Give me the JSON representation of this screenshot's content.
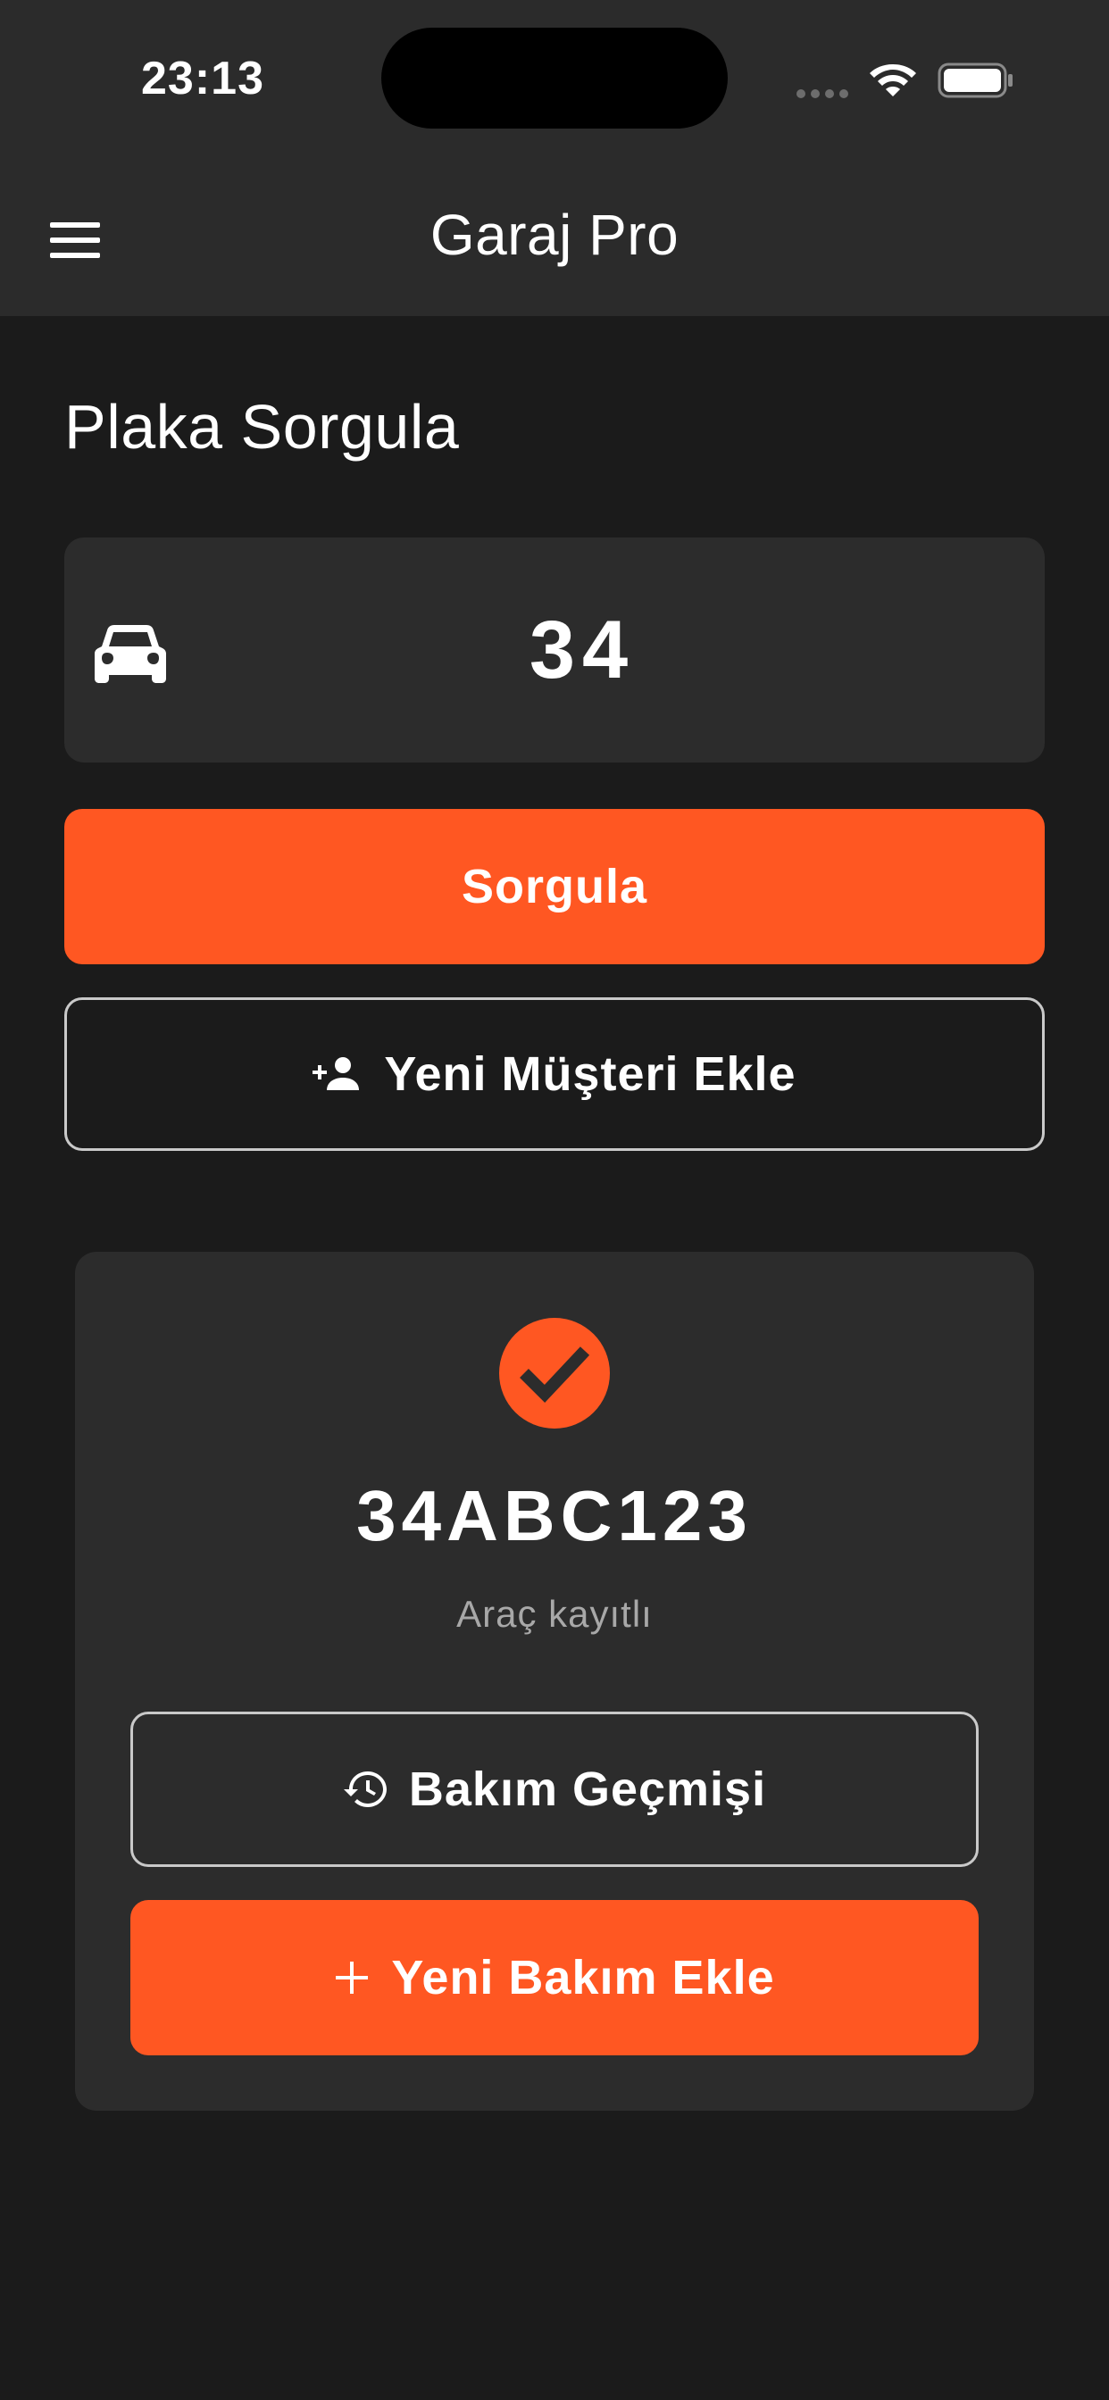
{
  "status_bar": {
    "time": "23:13"
  },
  "app_bar": {
    "title": "Garaj Pro",
    "menu_icon": "hamburger-menu-icon"
  },
  "plate_query": {
    "title": "Plaka Sorgula",
    "field_icon": "car-icon",
    "plate_value": "34",
    "query_button_label": "Sorgula",
    "add_customer_button_label": "Yeni Müşteri Ekle",
    "add_customer_icon": "person-add-icon"
  },
  "result": {
    "icon": "check-circle-icon",
    "plate": "34ABC123",
    "status": "Araç kayıtlı",
    "history_button_label": "Bakım Geçmişi",
    "history_icon": "history-icon",
    "add_service_button_label": "Yeni Bakım Ekle",
    "add_service_icon": "plus-icon"
  },
  "colors": {
    "accent": "#ff5722",
    "app_bar_bg": "#2b2b2b",
    "page_bg": "#1b1b1b",
    "surface": "#2c2c2c"
  }
}
